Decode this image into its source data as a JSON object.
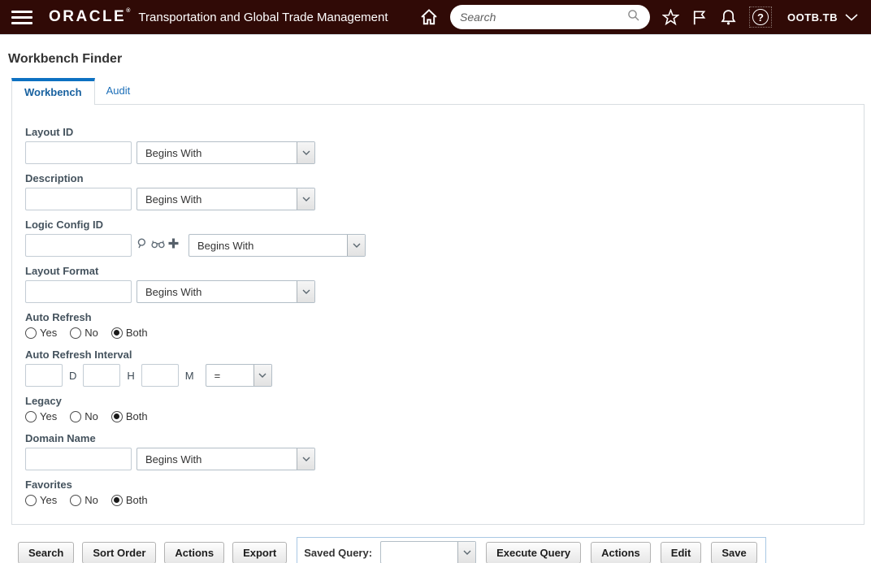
{
  "header": {
    "brand": "ORACLE",
    "brand_mark": "®",
    "app_title": "Transportation and Global Trade Management",
    "search_placeholder": "Search",
    "help_glyph": "?",
    "user_label": "OOTB.TB"
  },
  "page": {
    "title": "Workbench Finder"
  },
  "tabs": [
    {
      "label": "Workbench"
    },
    {
      "label": "Audit"
    }
  ],
  "form": {
    "layout_id": {
      "label": "Layout ID",
      "value": "",
      "operator": "Begins With"
    },
    "description": {
      "label": "Description",
      "value": "",
      "operator": "Begins With"
    },
    "logic_config_id": {
      "label": "Logic Config ID",
      "value": "",
      "operator": "Begins With"
    },
    "layout_format": {
      "label": "Layout Format",
      "value": "",
      "operator": "Begins With"
    },
    "auto_refresh": {
      "label": "Auto Refresh",
      "options": [
        "Yes",
        "No",
        "Both"
      ],
      "selected": "Both"
    },
    "auto_refresh_interval": {
      "label": "Auto Refresh Interval",
      "unit_labels": [
        "D",
        "H",
        "M"
      ],
      "values": [
        "",
        "",
        ""
      ],
      "operator": "="
    },
    "legacy": {
      "label": "Legacy",
      "options": [
        "Yes",
        "No",
        "Both"
      ],
      "selected": "Both"
    },
    "domain_name": {
      "label": "Domain Name",
      "value": "",
      "operator": "Begins With"
    },
    "favorites": {
      "label": "Favorites",
      "options": [
        "Yes",
        "No",
        "Both"
      ],
      "selected": "Both"
    }
  },
  "footer": {
    "search_button": "Search",
    "sort_order_button": "Sort Order",
    "actions_button": "Actions",
    "export_button": "Export",
    "saved_query_label": "Saved Query:",
    "saved_query_value": "",
    "execute_query_button": "Execute Query",
    "actions2_button": "Actions",
    "edit_button": "Edit",
    "save_button": "Save"
  },
  "colors": {
    "header_bg": "#300a06",
    "tab_accent": "#0d71c2",
    "link_blue": "#1d6fb8",
    "saved_query_border": "#a9c8e4"
  }
}
